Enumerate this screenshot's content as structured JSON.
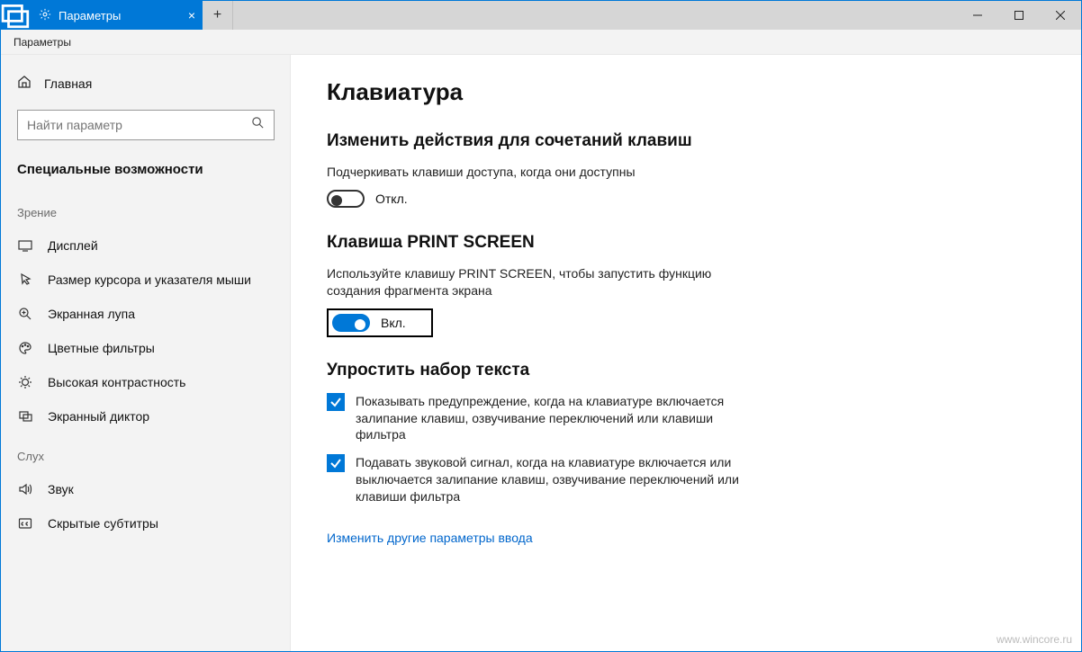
{
  "titlebar": {
    "tab_label": "Параметры"
  },
  "subtitle": "Параметры",
  "sidebar": {
    "home": "Главная",
    "search_placeholder": "Найти параметр",
    "category": "Специальные возможности",
    "group_vision": "Зрение",
    "items_vision": [
      "Дисплей",
      "Размер курсора и указателя мыши",
      "Экранная лупа",
      "Цветные фильтры",
      "Высокая контрастность",
      "Экранный диктор"
    ],
    "group_hearing": "Слух",
    "items_hearing": [
      "Звук",
      "Скрытые субтитры"
    ]
  },
  "content": {
    "title": "Клавиатура",
    "sec1_title": "Изменить действия для сочетаний клавиш",
    "sec1_desc": "Подчеркивать клавиши доступа, когда они доступны",
    "toggle_off": "Откл.",
    "sec2_title": "Клавиша PRINT SCREEN",
    "sec2_desc": "Используйте клавишу PRINT SCREEN, чтобы запустить функцию создания фрагмента экрана",
    "toggle_on": "Вкл.",
    "sec3_title": "Упростить набор текста",
    "check1": "Показывать предупреждение, когда на клавиатуре включается залипание клавиш, озвучивание переключений или клавиши фильтра",
    "check2": "Подавать звуковой сигнал, когда на клавиатуре включается или выключается залипание клавиш, озвучивание переключений или клавиши фильтра",
    "link": "Изменить другие параметры ввода"
  },
  "watermark": "www.wincore.ru"
}
